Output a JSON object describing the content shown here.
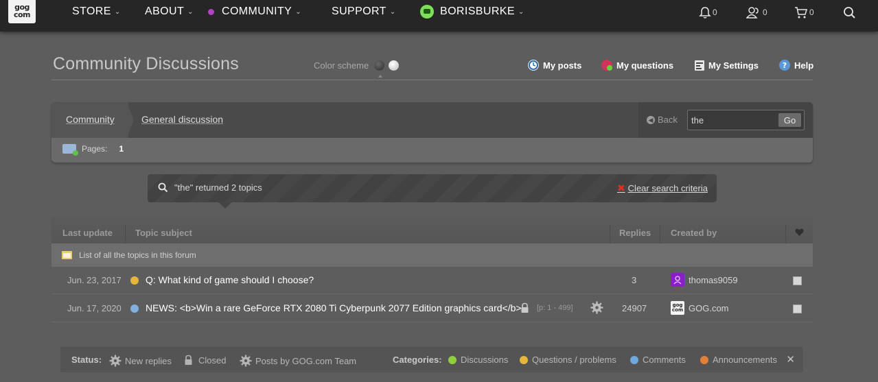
{
  "nav": {
    "logo_top": "gog",
    "logo_bottom": "com",
    "store": "STORE",
    "about": "ABOUT",
    "community": "COMMUNITY",
    "support": "SUPPORT",
    "user": "BORISBURKE",
    "notifications_count": "0",
    "friends_count": "0",
    "cart_count": "0"
  },
  "header": {
    "title": "Community Discussions",
    "color_scheme_label": "Color scheme",
    "my_posts": "My posts",
    "my_questions": "My questions",
    "my_settings": "My Settings",
    "help": "Help"
  },
  "breadcrumb": {
    "community": "Community",
    "forum": "General discussion",
    "back": "Back",
    "search_value": "the",
    "go": "Go",
    "pages_label": "Pages:",
    "current_page": "1"
  },
  "search_result": {
    "text": "\"the\" returned 2 topics",
    "clear": "Clear search criteria"
  },
  "table": {
    "headers": {
      "last_update": "Last update",
      "topic_subject": "Topic subject",
      "replies": "Replies",
      "created_by": "Created by"
    },
    "all_topics": "List of all the topics in this forum",
    "rows": [
      {
        "date": "Jun. 23, 2017",
        "title": "Q: What kind of game should I choose?",
        "replies": "3",
        "user": "thomas9059",
        "dot_color": "#e6b63a"
      },
      {
        "date": "Jun. 17, 2020",
        "title": "NEWS: <b>Win a rare GeForce RTX 2080 Ti Cyberpunk 2077 Edition graphics card</b>",
        "pages": "[p: 1 - 499]",
        "replies": "24907",
        "user": "GOG.com",
        "dot_color": "#7fb0e0"
      }
    ]
  },
  "legend": {
    "status_label": "Status:",
    "new_replies": "New replies",
    "closed": "Closed",
    "posts_by_team": "Posts by GOG.com Team",
    "categories_label": "Categories:",
    "discussions": "Discussions",
    "questions": "Questions / problems",
    "comments": "Comments",
    "announcements": "Announcements"
  },
  "colors": {
    "community_accent": "#b540c8",
    "discussions": "#8fcf3c",
    "questions": "#e6b63a",
    "comments": "#6fa8dc",
    "announcements": "#e2803a",
    "clear_x": "#e0301e"
  }
}
